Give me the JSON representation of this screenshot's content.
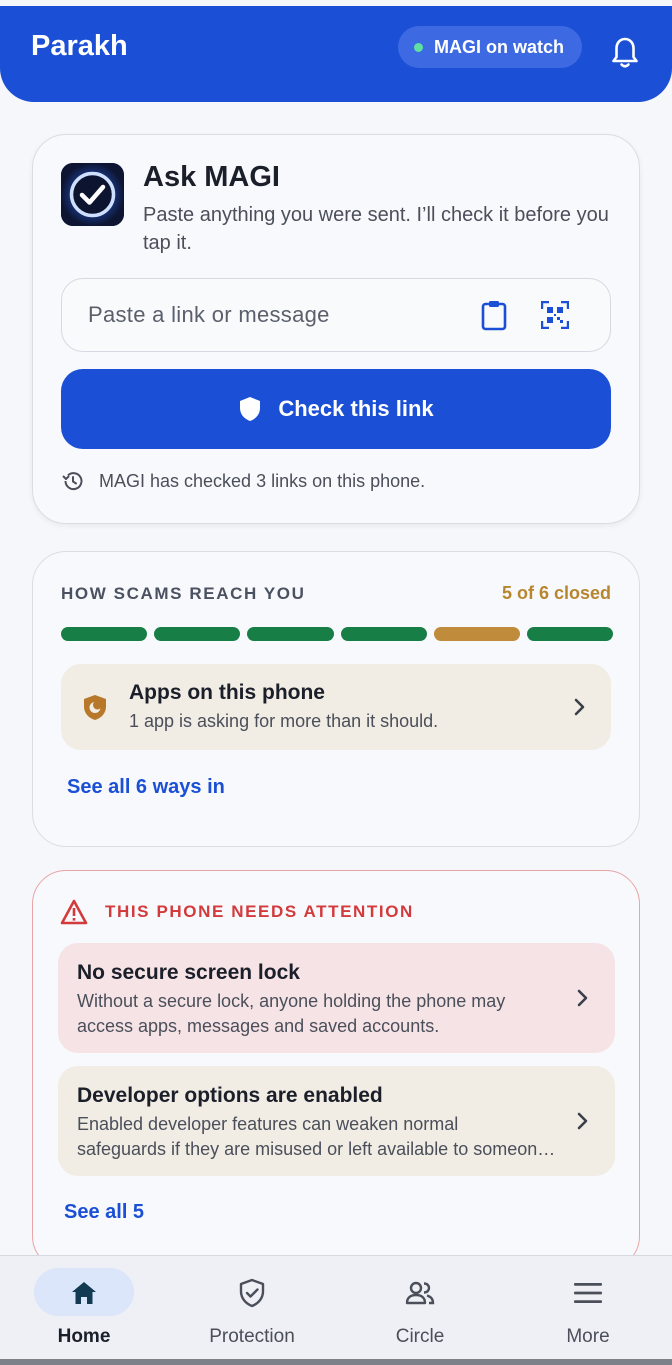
{
  "header": {
    "title": "Parakh",
    "status_pill": "MAGI on watch",
    "status_dot_color": "#5fe0a0",
    "notifications_icon": "bell-icon"
  },
  "ask": {
    "title": "Ask MAGI",
    "subtitle": "Paste anything you were sent. I’ll check it before you tap it.",
    "logo_icon": "checkmark-badge-icon",
    "input_placeholder": "Paste a link or message",
    "input_value": "",
    "paste_icon": "clipboard-icon",
    "scan_icon": "qr-scan-icon",
    "check_button": "Check this link",
    "check_icon": "shield-icon",
    "history_text": "MAGI has checked 3 links on this phone.",
    "history_icon": "history-icon"
  },
  "scams": {
    "label": "HOW SCAMS REACH YOU",
    "closed_count": "5 of 6 closed",
    "segments": [
      "closed",
      "closed",
      "closed",
      "closed",
      "open",
      "closed"
    ],
    "colors": {
      "closed": "#177e45",
      "open": "#c08b3a"
    },
    "apps_title": "Apps on this phone",
    "apps_subtitle": "1 app is asking for more than it should.",
    "apps_icon": "shield-warning-icon",
    "see_all": "See all 6 ways in"
  },
  "attention": {
    "label": "THIS PHONE NEEDS ATTENTION",
    "warning_icon": "warning-triangle-icon",
    "issues": [
      {
        "title": "No secure screen lock",
        "desc": "Without a secure lock, anyone holding the phone may access apps, messages and saved accounts."
      },
      {
        "title": "Developer options are enabled",
        "desc_line1": "Enabled developer features can weaken normal",
        "desc_line2": "safeguards if they are misused or left available to someone else."
      }
    ],
    "see_all": "See all 5"
  },
  "nav": {
    "items": [
      {
        "label": "Home",
        "icon": "home-icon",
        "active": true
      },
      {
        "label": "Protection",
        "icon": "shield-check-icon",
        "active": false
      },
      {
        "label": "Circle",
        "icon": "people-icon",
        "active": false
      },
      {
        "label": "More",
        "icon": "menu-icon",
        "active": false
      }
    ]
  },
  "theme": {
    "primary": "#1a4fd6",
    "danger": "#d23a3c",
    "amber": "#b8862e"
  }
}
